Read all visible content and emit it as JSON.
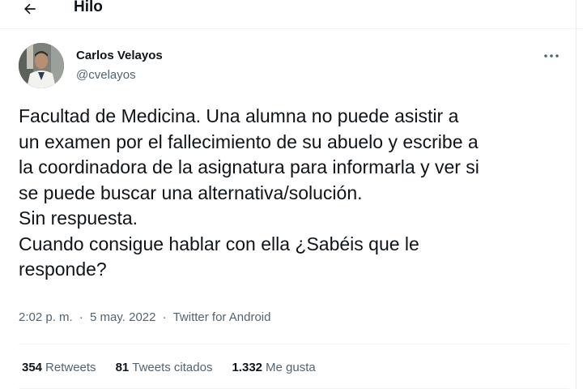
{
  "header": {
    "back_icon": "arrow-left-icon",
    "title": "Hilo"
  },
  "tweet": {
    "author": {
      "name": "Carlos Velayos",
      "handle": "@cvelayos",
      "avatar_icon": "profile-photo"
    },
    "more_icon": "more-horizontal-icon",
    "text_lines": [
      "Facultad de Medicina. Una alumna no puede asistir a",
      "un examen por el fallecimiento de su abuelo y escribe a",
      "la coordinadora de la asignatura para informarla y ver si",
      "se puede buscar una alternativa/solución.",
      "Sin respuesta.",
      "Cuando consigue hablar con ella ¿Sabéis que le",
      "responde?"
    ],
    "meta": {
      "time": "2:02 p. m.",
      "separator": "·",
      "date": "5 may. 2022",
      "source": "Twitter for Android"
    },
    "stats": {
      "retweets_count": "354",
      "retweets_label": "Retweets",
      "quotes_count": "81",
      "quotes_label": "Tweets citados",
      "likes_count": "1.332",
      "likes_label": "Me gusta"
    }
  },
  "colors": {
    "text_primary": "#0f1419",
    "text_secondary": "#536471",
    "divider": "#eff3f4"
  }
}
